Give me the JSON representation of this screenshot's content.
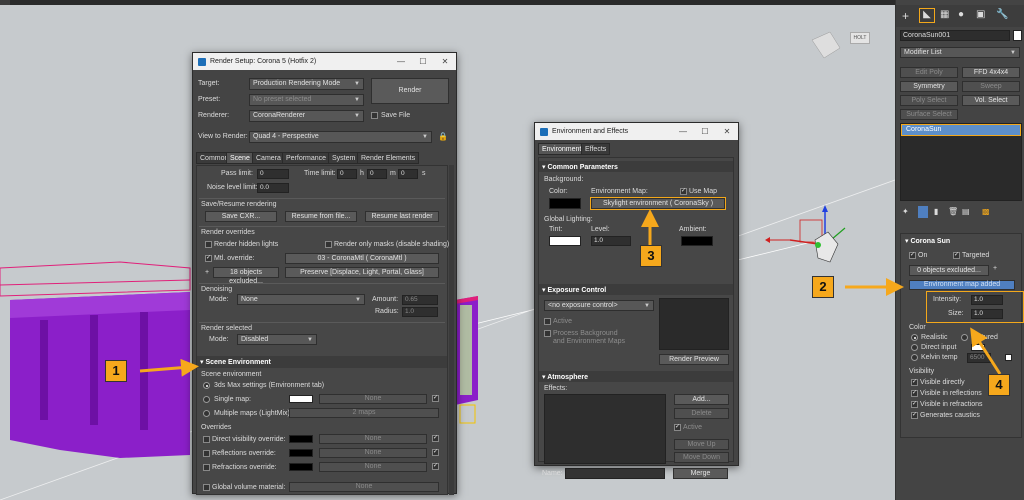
{
  "render_setup": {
    "title": "Render Setup: Corona 5 (Hotfix 2)",
    "target_label": "Target:",
    "target_value": "Production Rendering Mode",
    "preset_label": "Preset:",
    "preset_value": "No preset selected",
    "renderer_label": "Renderer:",
    "renderer_value": "CoronaRenderer",
    "save_file_label": "Save File",
    "view_label": "View to Render:",
    "view_value": "Quad 4 - Perspective",
    "render_button": "Render",
    "tabs": [
      "Common",
      "Scene",
      "Camera",
      "Performance",
      "System",
      "Render Elements"
    ],
    "pass_limit_label": "Pass limit:",
    "pass_limit_value": "0",
    "time_limit_label": "Time limit:",
    "time_h": "0",
    "time_m": "0",
    "time_s": "0",
    "unit_h": "h",
    "unit_m": "m",
    "unit_s": "s",
    "noise_label": "Noise level limit:",
    "noise_value": "0.0",
    "save_resume_title": "Save/Resume rendering",
    "save_cxr": "Save CXR...",
    "resume_file": "Resume from file...",
    "resume_last": "Resume last render",
    "overrides_title": "Render overrides",
    "render_hidden": "Render hidden lights",
    "render_masks": "Render only masks (disable shading)",
    "mtl_override": "Mtl. override:",
    "mtl_value": "03 - CoronaMtl  ( CoronaMtl )",
    "excluded": "18 objects excluded...",
    "preserve": "Preserve [Displace, Light, Portal, Glass]",
    "denoising_title": "Denoising",
    "mode_label": "Mode:",
    "mode_value": "None",
    "amount_label": "Amount:",
    "amount_value": "0.65",
    "radius_label": "Radius:",
    "radius_value": "1.0",
    "render_selected_title": "Render selected",
    "rs_mode_value": "Disabled",
    "scene_env_header": "Scene Environment",
    "scene_env_sub": "Scene environment",
    "env_3ds": "3ds Max settings (Environment tab)",
    "single_map": "Single map:",
    "none": "None",
    "multiple_maps": "Multiple maps (LightMix):",
    "maps_count": "2 maps",
    "overrides_label": "Overrides",
    "direct_vis": "Direct visibility override:",
    "reflections": "Reflections override:",
    "refractions": "Refractions override:",
    "global_volume": "Global volume material:"
  },
  "env_effects": {
    "title": "Environment and Effects",
    "tabs": [
      "Environment",
      "Effects"
    ],
    "common_params": "Common Parameters",
    "background": "Background:",
    "color": "Color:",
    "env_map": "Environment Map:",
    "use_map": "Use Map",
    "skylight": "Skylight environment  ( CoronaSky )",
    "global_lighting": "Global Lighting:",
    "tint": "Tint:",
    "level": "Level:",
    "level_value": "1.0",
    "ambient": "Ambient:",
    "exposure_header": "Exposure Control",
    "exposure_value": "<no exposure control>",
    "active": "Active",
    "process_bg": "Process Background",
    "process_bg2": "and Environment Maps",
    "render_preview": "Render Preview",
    "atmosphere_header": "Atmosphere",
    "effects_label": "Effects:",
    "add": "Add...",
    "delete": "Delete",
    "active2": "Active",
    "move_up": "Move Up",
    "move_down": "Move Down",
    "name_label": "Name:",
    "merge": "Merge"
  },
  "cmdpanel": {
    "object_name": "CoronaSun001",
    "modifier_list": "Modifier List",
    "btn_edit_poly": "Edit Poly",
    "btn_ffd": "FFD 4x4x4",
    "btn_symmetry": "Symmetry",
    "btn_sweep": "Sweep",
    "btn_poly_select": "Poly Select",
    "btn_vol_select": "Vol. Select",
    "btn_surface_select": "Surface Select",
    "stack_item": "CoronaSun",
    "rollout_title": "Corona Sun",
    "on": "On",
    "targeted": "Targeted",
    "excluded": "0 objects excluded...",
    "env_added": "Environment map added",
    "intensity_label": "Intensity:",
    "intensity_value": "1.0",
    "size_label": "Size:",
    "size_value": "1.0",
    "color_label": "Color",
    "realistic": "Realistic",
    "textured": "Textured",
    "direct_input": "Direct input",
    "kelvin": "Kelvin temp",
    "kelvin_value": "6500",
    "visibility": "Visibility",
    "vis_directly": "Visible directly",
    "vis_reflections": "Visible in reflections",
    "vis_refractions": "Visible in refractions",
    "caustics": "Generates caustics"
  },
  "viewport": {
    "nav_cube": "HOLT"
  },
  "callouts": [
    "1",
    "2",
    "3",
    "4"
  ],
  "colors": {
    "accent": "#f6a81c",
    "purple": "#8b1fc9",
    "panel": "#444444"
  }
}
